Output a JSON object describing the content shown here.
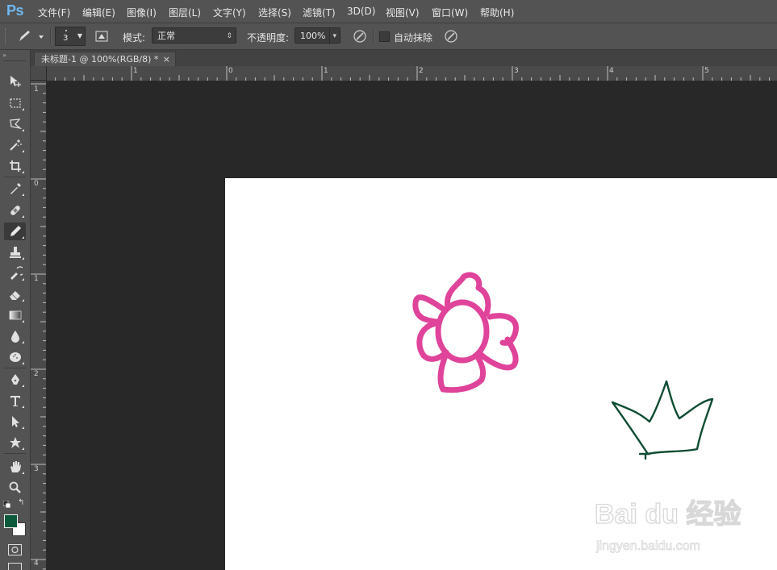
{
  "app": {
    "logo": "Ps"
  },
  "menu": {
    "items": [
      "文件(F)",
      "编辑(E)",
      "图像(I)",
      "图层(L)",
      "文字(Y)",
      "选择(S)",
      "滤镜(T)",
      "3D(D)",
      "视图(V)",
      "窗口(W)",
      "帮助(H)"
    ]
  },
  "options": {
    "brush_size": "3",
    "mode_label": "模式:",
    "mode_value": "正常",
    "opacity_label": "不透明度:",
    "opacity_value": "100%",
    "auto_erase_label": "自动抹除",
    "auto_erase_checked": false
  },
  "document": {
    "tab_title": "未标题-1 @ 100%(RGB/8) *",
    "close_glyph": "×"
  },
  "rulers": {
    "horizontal_labels": [
      "1",
      "0",
      "1",
      "2",
      "3",
      "4",
      "5"
    ],
    "vertical_labels": [
      "1",
      "0",
      "1",
      "2",
      "3",
      "4"
    ]
  },
  "colors": {
    "foreground": "#0c5a3c",
    "background": "#ffffff",
    "flower_stroke": "#e0439a",
    "crown_stroke": "#0f4d33"
  },
  "tools": [
    "move-tool",
    "marquee-tool",
    "lasso-tool",
    "magic-wand-tool",
    "crop-tool",
    "eyedropper-tool",
    "healing-brush-tool",
    "pencil-tool",
    "clone-stamp-tool",
    "history-brush-tool",
    "eraser-tool",
    "gradient-tool",
    "blur-tool",
    "dodge-tool",
    "pen-tool",
    "type-tool",
    "path-selection-tool",
    "custom-shape-tool",
    "hand-tool",
    "zoom-tool"
  ],
  "watermark": {
    "brand": "Bai du 经验",
    "url": "jingyen.baidu.com"
  }
}
